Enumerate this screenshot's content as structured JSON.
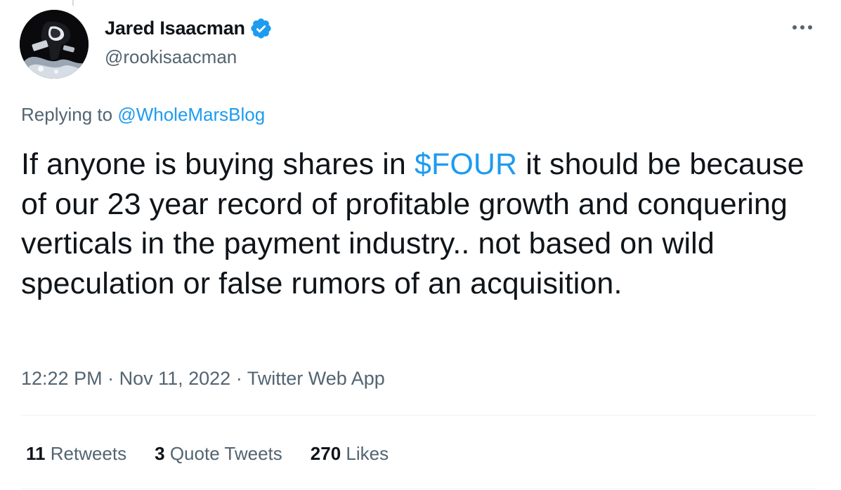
{
  "tweet": {
    "author": {
      "display_name": "Jared Isaacman",
      "handle": "@rookisaacman",
      "verified": true,
      "avatar_icon": "astronaut-spacewalk-avatar"
    },
    "reply": {
      "prefix": "Replying to ",
      "target": "@WholeMarsBlog"
    },
    "text": {
      "before": "If anyone is buying shares in ",
      "cashtag": "$FOUR",
      "after": " it should be because of our 23 year record of profitable growth and conquering verticals in the payment industry.. not based on wild speculation or false rumors of an acquisition."
    },
    "meta": {
      "time": "12:22 PM",
      "separator": " · ",
      "date": "Nov 11, 2022",
      "source": "Twitter Web App"
    },
    "stats": {
      "retweets": {
        "count": "11",
        "label": "Retweets"
      },
      "quote_tweets": {
        "count": "3",
        "label": "Quote Tweets"
      },
      "likes": {
        "count": "270",
        "label": "Likes"
      }
    }
  },
  "icons": {
    "verified": "verified-badge-icon",
    "more": "more-options-icon"
  },
  "colors": {
    "accent": "#1d9bf0",
    "text_primary": "#0f1419",
    "text_secondary": "#536471",
    "divider": "#eff3f4"
  }
}
